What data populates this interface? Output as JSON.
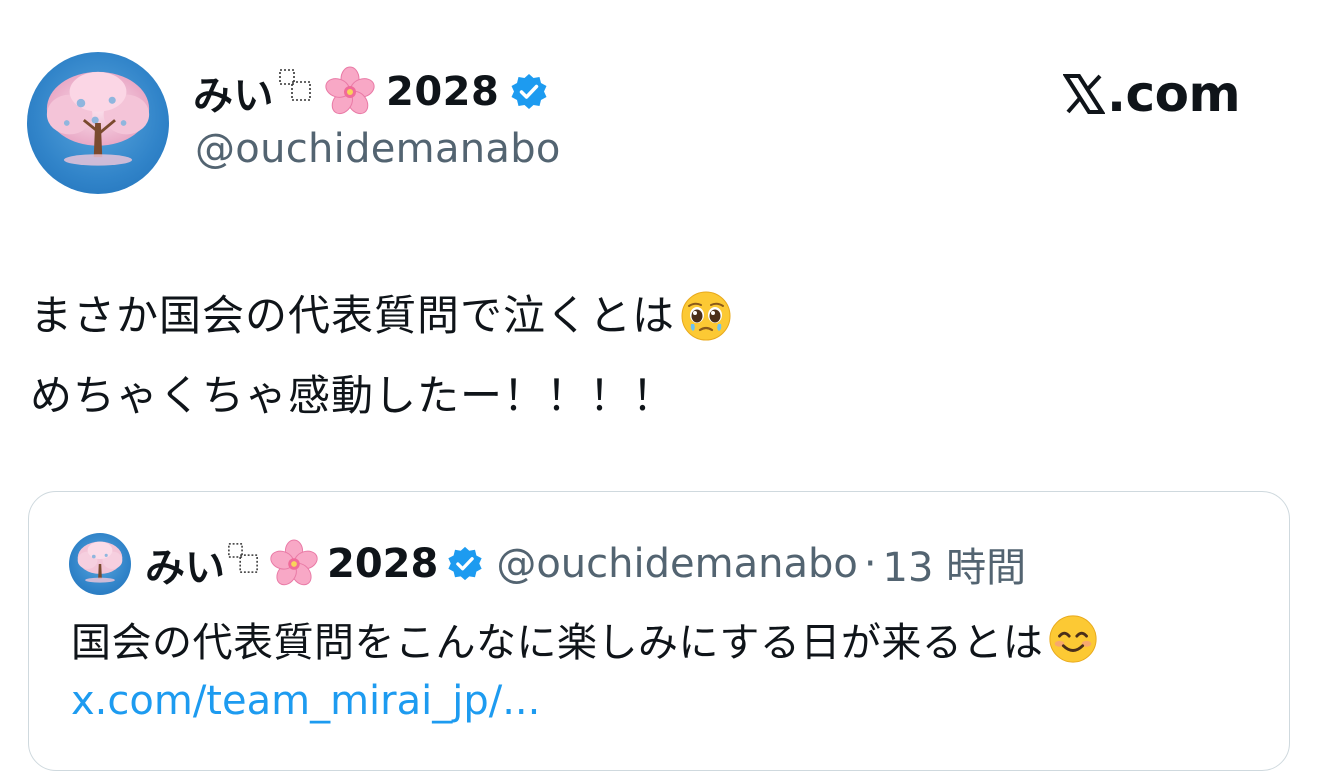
{
  "author": {
    "name": "みい",
    "name_suffix": "2028",
    "handle": "@ouchidemanabo",
    "verified": true,
    "avatar_icon": "cherry-blossom-tree-avatar",
    "name_emoji": "cherry-blossom-icon"
  },
  "brand": {
    "logo_text": ".com",
    "logo_icon": "x-logo-icon"
  },
  "tweet": {
    "lines": [
      "まさか国会の代表質問で泣くとは",
      "めちゃくちゃ感動したー！！！！"
    ],
    "line1_emoji": "pleading-face-icon"
  },
  "quoted": {
    "name": "みい",
    "name_suffix": "2028",
    "handle": "@ouchidemanabo",
    "separator": "·",
    "time": "13 時間",
    "text": "国会の代表質問をこんなに楽しみにする日が来るとは",
    "text_emoji": "smiling-face-icon",
    "link": "x.com/team_mirai_jp/..."
  },
  "colors": {
    "text": "#0f1419",
    "secondary": "#536471",
    "link": "#1d9bf0",
    "verified": "#1d9bf0",
    "border": "#cfd9de"
  }
}
